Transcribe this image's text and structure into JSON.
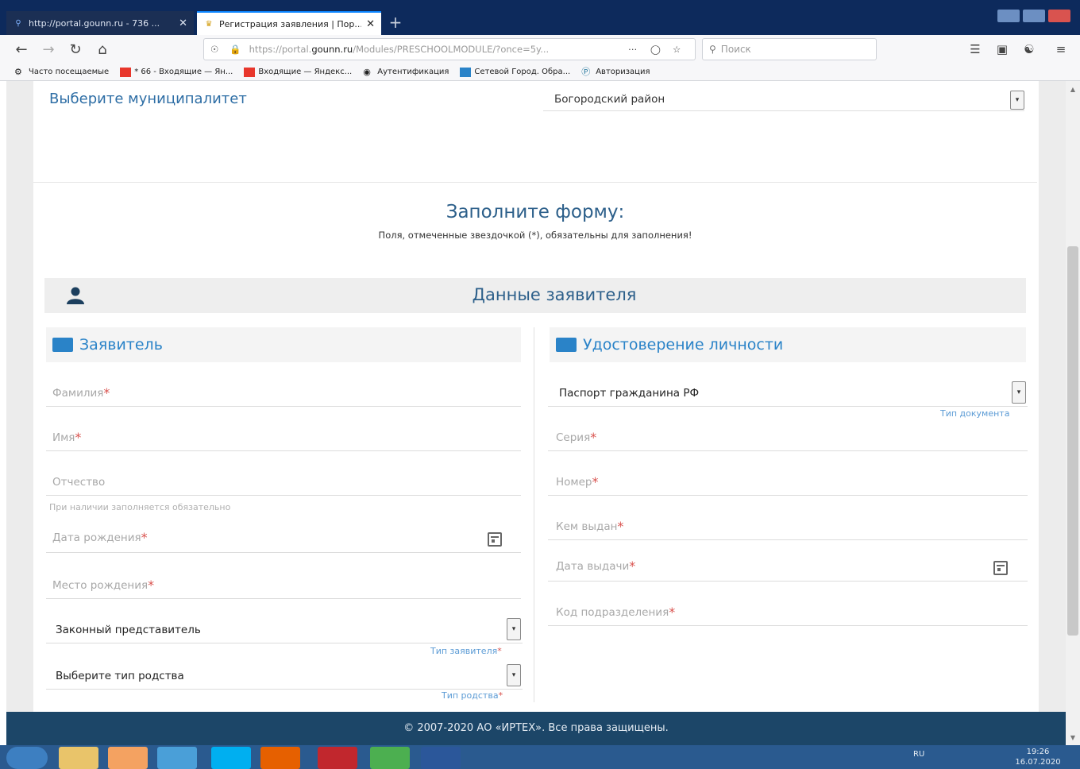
{
  "browser": {
    "tabs": [
      {
        "title": "http://portal.gounn.ru - 736 ...",
        "active": false
      },
      {
        "title": "Регистрация заявления | Пор...",
        "active": true
      }
    ],
    "url_prefix": "https://portal.",
    "url_host": "gounn.ru",
    "url_path": "/Modules/PRESCHOOLMODULE/?once=5y...",
    "search_placeholder": "Поиск",
    "bookmarks": [
      "Часто посещаемые",
      "* 66 - Входящие — Ян...",
      "Входящие — Яндекс...",
      "Аутентификация",
      "Сетевой Город. Обра...",
      "Авторизация"
    ]
  },
  "page": {
    "municipality_label": "Выберите муниципалитет",
    "municipality_value": "Богородский район",
    "form_title": "Заполните форму:",
    "form_subtitle": "Поля, отмеченные звездочкой (*), обязательны для заполнения!",
    "section_title": "Данные заявителя",
    "left_heading": "Заявитель",
    "right_heading": "Удостоверение личности",
    "left_fields": {
      "surname": "Фамилия",
      "name": "Имя",
      "patronymic": "Отчество",
      "patronymic_note": "При наличии заполняется обязательно",
      "birth_date": "Дата рождения",
      "birth_place": "Место рождения",
      "applicant_type_value": "Законный представитель",
      "applicant_type_hint": "Тип заявителя",
      "relation_value": "Выберите тип родства",
      "relation_hint": "Тип родства"
    },
    "right_fields": {
      "doc_type_value": "Паспорт гражданина РФ",
      "doc_type_hint": "Тип документа",
      "series": "Серия",
      "number": "Номер",
      "issued_by": "Кем выдан",
      "issue_date": "Дата выдачи",
      "division_code": "Код подразделения"
    },
    "required_mark": "*",
    "footer": "© 2007-2020 АО «ИРТЕХ». Все права защищены."
  },
  "taskbar": {
    "lang": "RU",
    "time": "19:26",
    "date": "16.07.2020"
  },
  "colors": {
    "primary": "#2a83c8",
    "heading": "#2c5f8a",
    "footer_bg": "#1c4668",
    "required": "#d9534f"
  }
}
